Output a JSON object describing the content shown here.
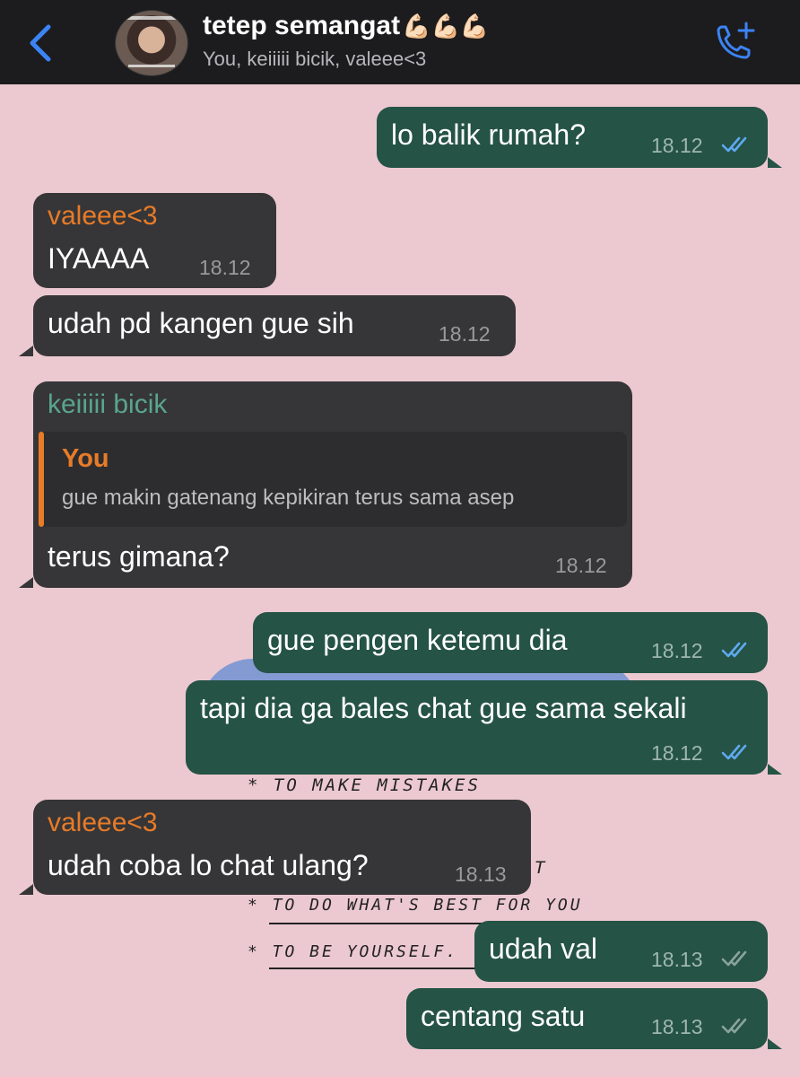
{
  "header": {
    "title": "tetep semangat",
    "title_emoji": "💪🏻💪🏻💪🏻",
    "members": "You, keiiiii bicik, valeee<3"
  },
  "icons": {
    "back": "chevron-left-icon",
    "call": "add-call-icon",
    "read": "double-check-icon"
  },
  "colors": {
    "accent": "#3c84f5",
    "read_tick": "#5fa9f0",
    "sent_tick": "#8aa39b",
    "sender_vale": "#e77b28",
    "sender_kei": "#5aa58c"
  },
  "wallpaper": {
    "line1": "* TO MAKE MISTAKES",
    "line2": "T",
    "line3": "* TO DO WHAT'S BEST FOR YOU",
    "line4": "* TO BE YOURSELF."
  },
  "messages": [
    {
      "text": "lo balik rumah?",
      "time": "18.12",
      "status": "read"
    },
    {
      "sender": "valeee<3",
      "text": "IYAAAA",
      "time": "18.12"
    },
    {
      "text": "udah pd kangen gue sih",
      "time": "18.12"
    },
    {
      "sender": "keiiiii bicik",
      "quote_author": "You",
      "quote_text": "gue makin gatenang kepikiran terus sama asep",
      "text": "terus gimana?",
      "time": "18.12"
    },
    {
      "text": "gue pengen ketemu dia",
      "time": "18.12",
      "status": "read"
    },
    {
      "text": "tapi dia ga bales chat gue sama sekali",
      "time": "18.12",
      "status": "read"
    },
    {
      "sender": "valeee<3",
      "text": "udah coba lo chat ulang?",
      "time": "18.13"
    },
    {
      "text": "udah val",
      "time": "18.13",
      "status": "delivered"
    },
    {
      "text": "centang satu",
      "time": "18.13",
      "status": "delivered"
    }
  ]
}
